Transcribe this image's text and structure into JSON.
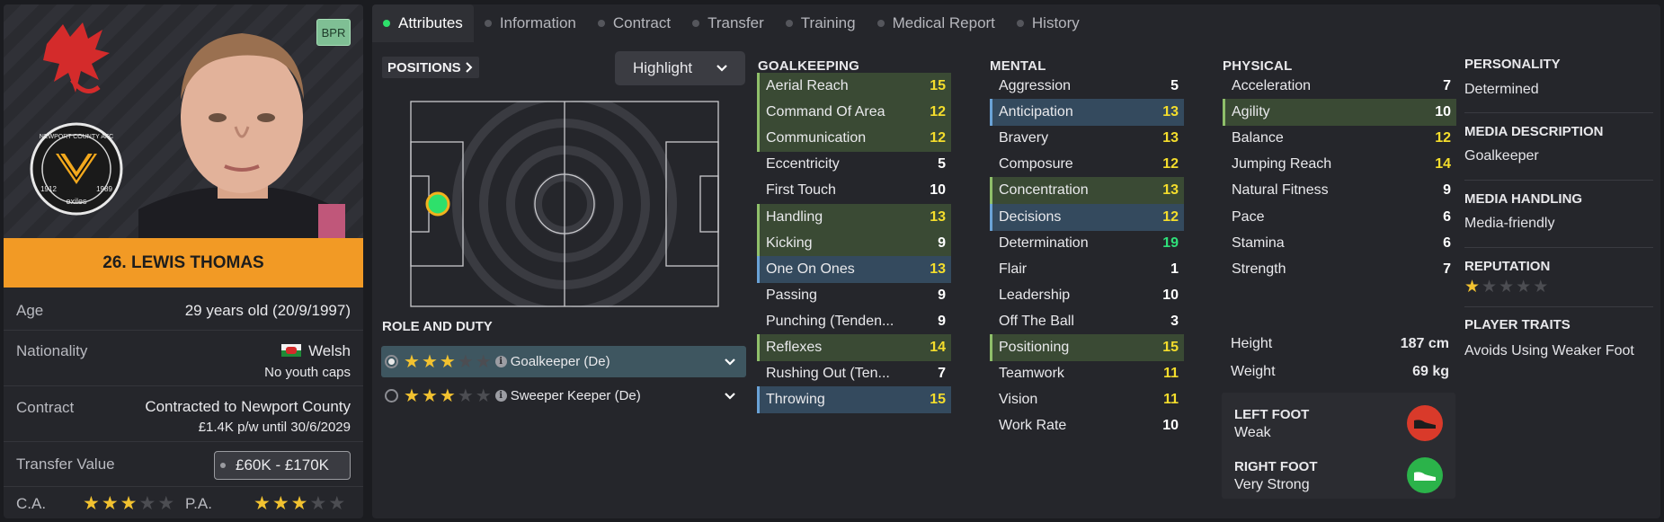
{
  "player": {
    "name": "26. LEWIS THOMAS",
    "badge": "BPR",
    "age_label": "Age",
    "age_value": "29 years old (20/9/1997)",
    "nationality_label": "Nationality",
    "nationality_value": "Welsh",
    "nationality_sub": "No youth caps",
    "contract_label": "Contract",
    "contract_value": "Contracted to Newport County",
    "contract_sub": "£1.4K p/w until 30/6/2029",
    "transfer_label": "Transfer Value",
    "transfer_value": "£60K - £170K",
    "ca_label": "C.A.",
    "pa_label": "P.A.",
    "ca_stars": 3,
    "pa_stars": 3,
    "club_badge_text": [
      "NEWPORT COUNTY AFC",
      "1912",
      "exiles",
      "1989"
    ]
  },
  "tabs": [
    "Attributes",
    "Information",
    "Contract",
    "Transfer",
    "Training",
    "Medical Report",
    "History"
  ],
  "positions": {
    "button_label": "POSITIONS",
    "highlight_label": "Highlight"
  },
  "roles": {
    "title": "ROLE AND DUTY",
    "items": [
      {
        "name": "Goalkeeper (De)",
        "stars": 3,
        "selected": true
      },
      {
        "name": "Sweeper Keeper (De)",
        "stars": 3,
        "selected": false
      }
    ]
  },
  "goalkeeping": {
    "title": "GOALKEEPING",
    "rows": [
      {
        "name": "Aerial Reach",
        "value": "15",
        "hl": "green",
        "color": "yellow"
      },
      {
        "name": "Command Of Area",
        "value": "12",
        "hl": "green",
        "color": "yellow"
      },
      {
        "name": "Communication",
        "value": "12",
        "hl": "green",
        "color": "yellow"
      },
      {
        "name": "Eccentricity",
        "value": "5",
        "hl": "",
        "color": "white"
      },
      {
        "name": "First Touch",
        "value": "10",
        "hl": "",
        "color": "white"
      },
      {
        "name": "Handling",
        "value": "13",
        "hl": "green",
        "color": "yellow"
      },
      {
        "name": "Kicking",
        "value": "9",
        "hl": "green",
        "color": "white"
      },
      {
        "name": "One On Ones",
        "value": "13",
        "hl": "blue",
        "color": "yellow"
      },
      {
        "name": "Passing",
        "value": "9",
        "hl": "",
        "color": "white"
      },
      {
        "name": "Punching (Tenden...",
        "value": "9",
        "hl": "",
        "color": "white"
      },
      {
        "name": "Reflexes",
        "value": "14",
        "hl": "green",
        "color": "yellow"
      },
      {
        "name": "Rushing Out (Ten...",
        "value": "7",
        "hl": "",
        "color": "white"
      },
      {
        "name": "Throwing",
        "value": "15",
        "hl": "blue",
        "color": "yellow"
      }
    ]
  },
  "mental": {
    "title": "MENTAL",
    "rows": [
      {
        "name": "Aggression",
        "value": "5",
        "hl": "",
        "color": "white"
      },
      {
        "name": "Anticipation",
        "value": "13",
        "hl": "blue",
        "color": "yellow"
      },
      {
        "name": "Bravery",
        "value": "13",
        "hl": "",
        "color": "yellow"
      },
      {
        "name": "Composure",
        "value": "12",
        "hl": "",
        "color": "yellow"
      },
      {
        "name": "Concentration",
        "value": "13",
        "hl": "green",
        "color": "yellow"
      },
      {
        "name": "Decisions",
        "value": "12",
        "hl": "blue",
        "color": "yellow"
      },
      {
        "name": "Determination",
        "value": "19",
        "hl": "",
        "color": "green"
      },
      {
        "name": "Flair",
        "value": "1",
        "hl": "",
        "color": "white"
      },
      {
        "name": "Leadership",
        "value": "10",
        "hl": "",
        "color": "white"
      },
      {
        "name": "Off The Ball",
        "value": "3",
        "hl": "",
        "color": "white"
      },
      {
        "name": "Positioning",
        "value": "15",
        "hl": "green",
        "color": "yellow"
      },
      {
        "name": "Teamwork",
        "value": "11",
        "hl": "",
        "color": "yellow"
      },
      {
        "name": "Vision",
        "value": "11",
        "hl": "",
        "color": "yellow"
      },
      {
        "name": "Work Rate",
        "value": "10",
        "hl": "",
        "color": "white"
      }
    ]
  },
  "physical": {
    "title": "PHYSICAL",
    "rows": [
      {
        "name": "Acceleration",
        "value": "7",
        "hl": "",
        "color": "white"
      },
      {
        "name": "Agility",
        "value": "10",
        "hl": "green",
        "color": "white"
      },
      {
        "name": "Balance",
        "value": "12",
        "hl": "",
        "color": "yellow"
      },
      {
        "name": "Jumping Reach",
        "value": "14",
        "hl": "",
        "color": "yellow"
      },
      {
        "name": "Natural Fitness",
        "value": "9",
        "hl": "",
        "color": "white"
      },
      {
        "name": "Pace",
        "value": "6",
        "hl": "",
        "color": "white"
      },
      {
        "name": "Stamina",
        "value": "6",
        "hl": "",
        "color": "white"
      },
      {
        "name": "Strength",
        "value": "7",
        "hl": "",
        "color": "white"
      }
    ],
    "height_label": "Height",
    "height_value": "187 cm",
    "weight_label": "Weight",
    "weight_value": "69 kg",
    "left_foot_label": "LEFT FOOT",
    "left_foot_value": "Weak",
    "right_foot_label": "RIGHT FOOT",
    "right_foot_value": "Very Strong"
  },
  "meta": {
    "personality_label": "PERSONALITY",
    "personality_value": "Determined",
    "media_desc_label": "MEDIA DESCRIPTION",
    "media_desc_value": "Goalkeeper",
    "media_handling_label": "MEDIA HANDLING",
    "media_handling_value": "Media-friendly",
    "reputation_label": "REPUTATION",
    "reputation_stars": 1,
    "traits_label": "PLAYER TRAITS",
    "traits_value": "Avoids Using Weaker Foot"
  },
  "colors": {
    "accent_orange": "#f29a25",
    "value_yellow": "#f4dd2c",
    "value_green": "#2fe07a",
    "weak_foot_red": "#d93a2a",
    "strong_foot_green": "#2bb34a"
  }
}
